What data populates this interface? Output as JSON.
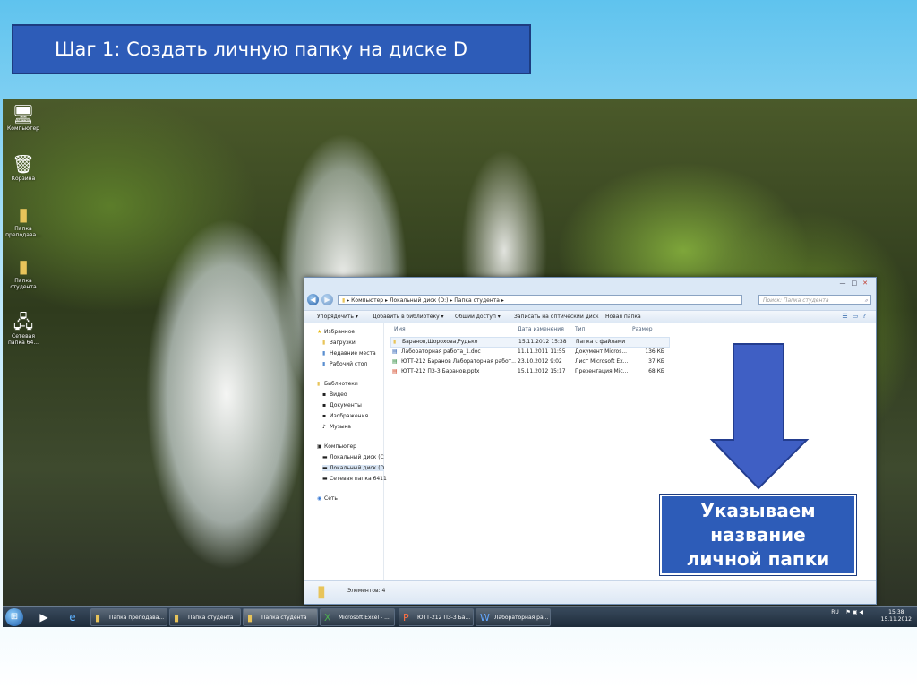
{
  "slide": {
    "title": "Шаг 1: Создать личную папку на диске D",
    "callout": [
      "Указываем",
      "название",
      "личной папки"
    ],
    "colors": {
      "box": "#2d5cb8",
      "arrow": "#3f5fc4"
    }
  },
  "desktop_icons": [
    {
      "label": "Компьютер",
      "icon": "computer-icon"
    },
    {
      "label": "Корзина",
      "icon": "recycle-bin-icon"
    },
    {
      "label": "Папка преподава...",
      "icon": "folder-icon"
    },
    {
      "label": "Папка студента",
      "icon": "folder-icon"
    },
    {
      "label": "Сетевая папка 64...",
      "icon": "network-folder-icon"
    }
  ],
  "explorer": {
    "address": [
      "Компьютер",
      "Локальный диск (D:)",
      "Папка студента"
    ],
    "search_placeholder": "Поиск: Папка студента",
    "toolbar": [
      "Упорядочить ▾",
      "Добавить в библиотеку ▾",
      "Общий доступ ▾",
      "Записать на оптический диск",
      "Новая папка"
    ],
    "nav": {
      "favorites": "Избранное",
      "fav_items": [
        "Загрузки",
        "Недавние места",
        "Рабочий стол"
      ],
      "libraries": "Библиотеки",
      "lib_items": [
        "Видео",
        "Документы",
        "Изображения",
        "Музыка"
      ],
      "computer": "Компьютер",
      "comp_items": [
        "Локальный диск (C",
        "Локальный диск (D",
        "Сетевая папка 6411"
      ],
      "network": "Сеть"
    },
    "columns": {
      "name": "Имя",
      "date": "Дата изменения",
      "type": "Тип",
      "size": "Размер"
    },
    "files": [
      {
        "name": "Баранов,Шорохова,Рудько",
        "date": "15.11.2012 15:38",
        "type": "Папка с файлами",
        "size": "",
        "icon": "folder-icon"
      },
      {
        "name": "Лабораторная работа_1.doc",
        "date": "11.11.2011 11:55",
        "type": "Документ Micros...",
        "size": "136 КБ",
        "icon": "word-doc-icon"
      },
      {
        "name": "ЮТТ-212 Баранов Лабораторная работ...",
        "date": "23.10.2012 9:02",
        "type": "Лист Microsoft Ex...",
        "size": "37 КБ",
        "icon": "excel-sheet-icon"
      },
      {
        "name": "ЮТТ-212 ПЗ-3 Баранов.pptx",
        "date": "15.11.2012 15:17",
        "type": "Презентация Mic...",
        "size": "68 КБ",
        "icon": "powerpoint-icon"
      }
    ],
    "status": "Элементов: 4"
  },
  "taskbar": {
    "buttons": [
      "Папка преподава...",
      "Папка студента",
      "Папка студента",
      "Microsoft Excel - ...",
      "ЮТТ-212 ПЗ-3 Ба...",
      "Лабораторная ра..."
    ],
    "lang": "RU",
    "time": "15:38",
    "date": "15.11.2012"
  }
}
